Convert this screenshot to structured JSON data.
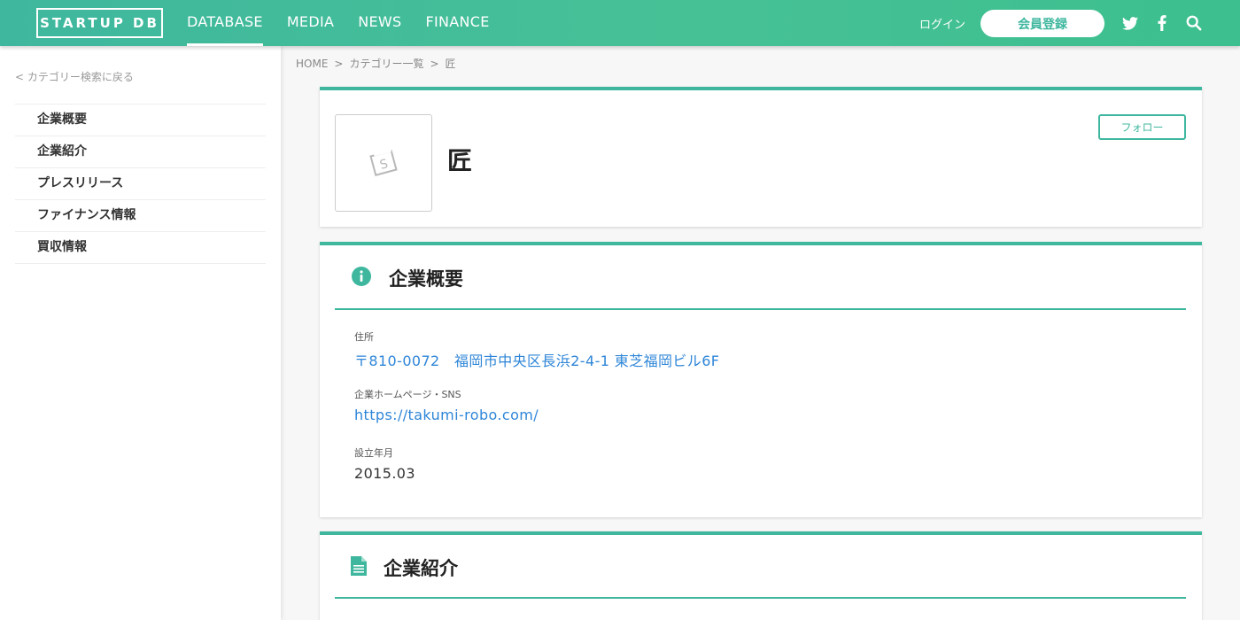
{
  "header": {
    "logo": "STARTUP DB",
    "nav": [
      "DATABASE",
      "MEDIA",
      "NEWS",
      "FINANCE"
    ],
    "login": "ログイン",
    "register": "会員登録",
    "social_icons": [
      "twitter-icon",
      "facebook-icon",
      "search-icon"
    ]
  },
  "sidebar": {
    "back": "< カテゴリー検索に戻る",
    "items": [
      "企業概要",
      "企業紹介",
      "プレスリリース",
      "ファイナンス情報",
      "買収情報"
    ]
  },
  "breadcrumb": [
    "HOME",
    "カテゴリー一覧",
    "匠"
  ],
  "breadcrumb_sep": ">",
  "company": {
    "name": "匠",
    "follow": "フォロー"
  },
  "overview": {
    "title": "企業概要",
    "address_label": "住所",
    "address": "〒810-0072　福岡市中央区長浜2-4-1 東芝福岡ビル6F",
    "homepage_label": "企業ホームページ・SNS",
    "homepage": "https://takumi-robo.com/",
    "founded_label": "設立年月",
    "founded": "2015.03"
  },
  "intro": {
    "title": "企業紹介"
  },
  "colors": {
    "accent": "#3fb79e",
    "link": "#2f86d8"
  }
}
